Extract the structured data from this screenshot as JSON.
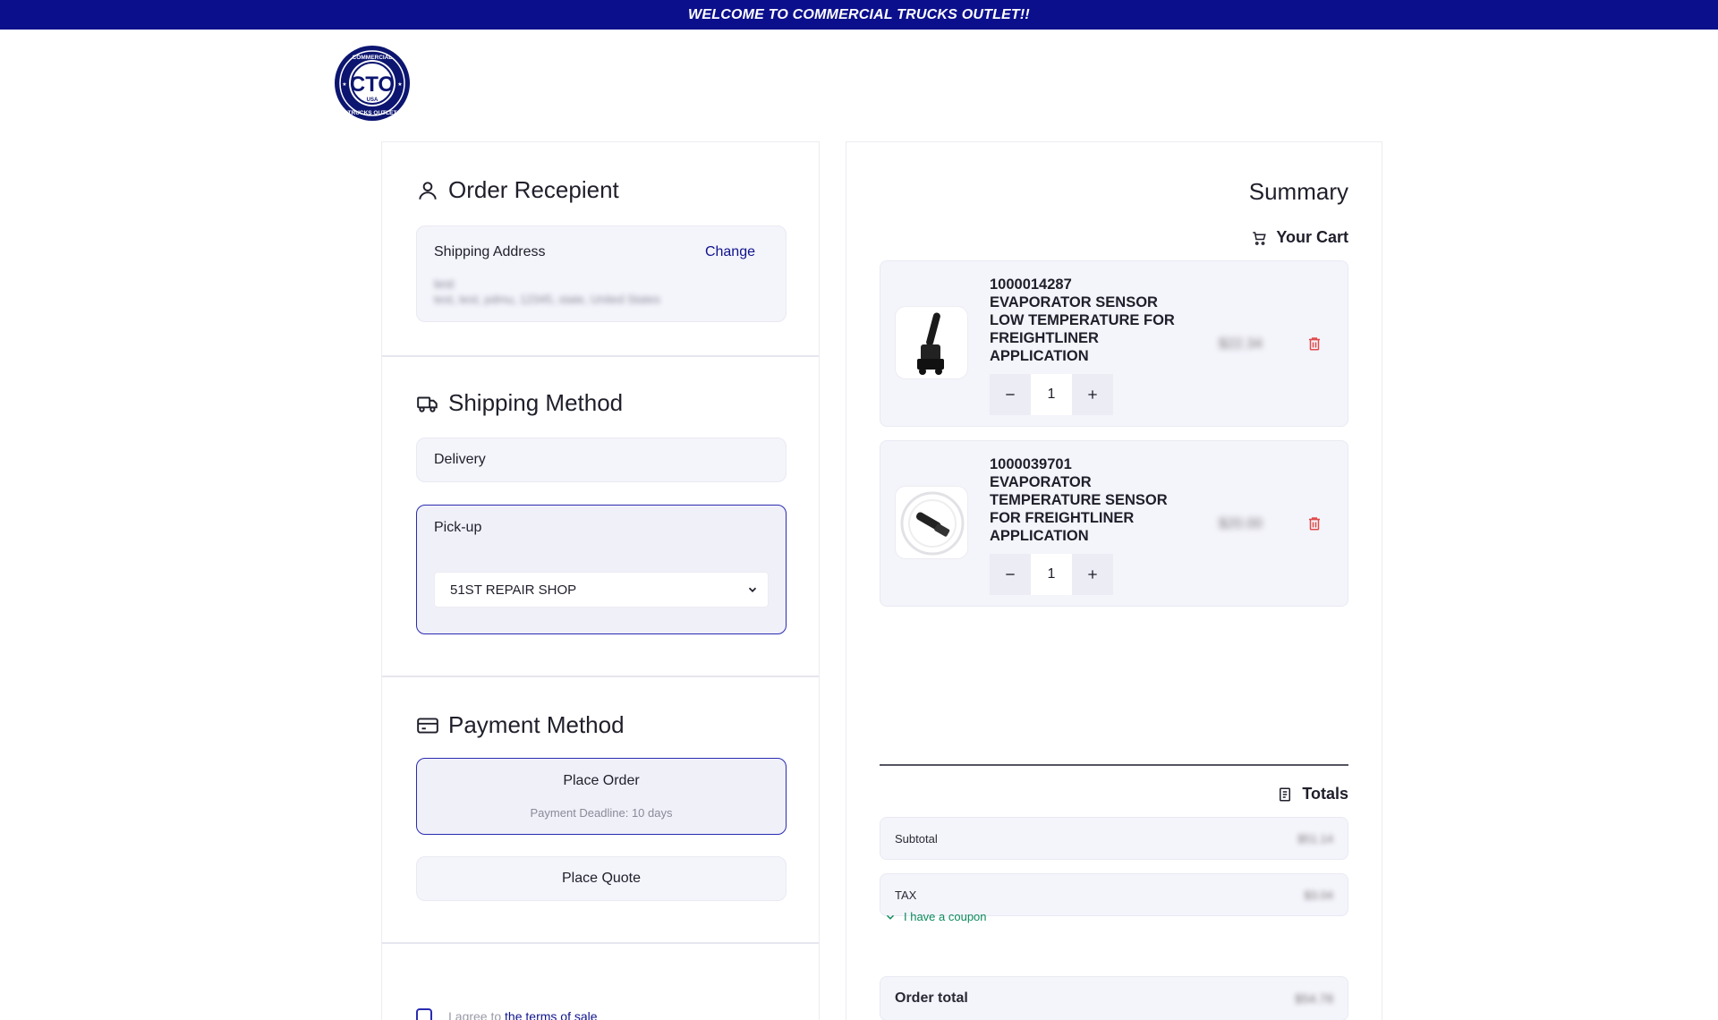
{
  "topbar": {
    "text": "WELCOME TO COMMERCIAL TRUCKS OUTLET!!"
  },
  "logo": {
    "main": "CTO",
    "ring_top": "COMMERCIAL",
    "ring_bottom": "TRUCKS OUTLET",
    "sub": "USA"
  },
  "recipient": {
    "title": "Order Recepient",
    "address_label": "Shipping Address",
    "change_label": "Change",
    "address_name": "test",
    "address_line": "test, test, pdmu, 12345, state, United States"
  },
  "shipping": {
    "title": "Shipping Method",
    "delivery_label": "Delivery",
    "pickup_label": "Pick-up",
    "pickup_selected": "51ST REPAIR SHOP"
  },
  "payment": {
    "title": "Payment Method",
    "place_order_label": "Place Order",
    "place_order_sub": "Payment Deadline: 10 days",
    "place_quote_label": "Place Quote"
  },
  "terms": {
    "prefix": "I agree to ",
    "link": "the terms of sale"
  },
  "summary": {
    "title": "Summary",
    "cart_label": "Your Cart",
    "items": [
      {
        "sku": "1000014287",
        "name": "EVAPORATOR SENSOR LOW TEMPERATURE FOR FREIGHTLINER APPLICATION",
        "price": "$22.34",
        "qty": "1"
      },
      {
        "sku": "1000039701",
        "name": "EVAPORATOR TEMPERATURE SENSOR FOR FREIGHTLINER APPLICATION",
        "price": "$20.00",
        "qty": "1"
      }
    ],
    "totals_label": "Totals",
    "subtotal_label": "Subtotal",
    "subtotal_value": "$51.14",
    "tax_label": "TAX",
    "tax_value": "$3.04",
    "coupon_label": "I have a coupon",
    "order_total_label": "Order total",
    "order_total_value": "$54.78"
  },
  "colors": {
    "brand": "#0c0f8c",
    "selected_border": "#2a2cb0",
    "danger": "#e04a4a",
    "coupon": "#0b8a5c"
  }
}
